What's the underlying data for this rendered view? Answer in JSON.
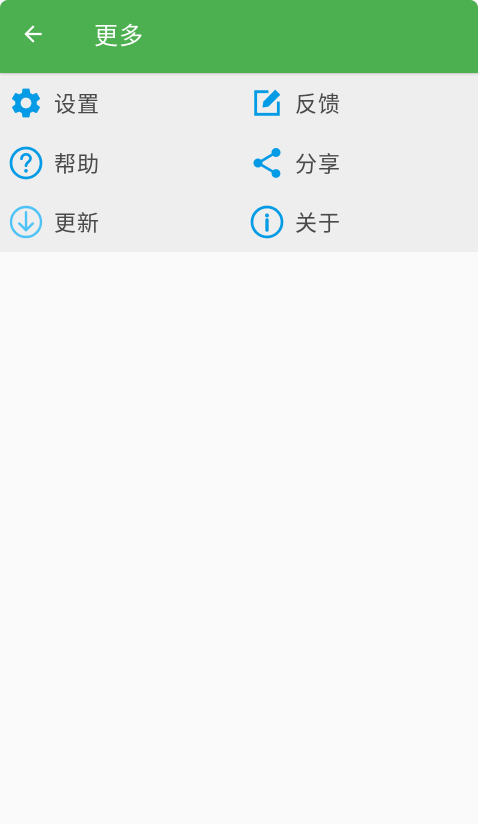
{
  "header": {
    "title": "更多",
    "back_icon": "arrow-left-icon"
  },
  "colors": {
    "appbar": "#4caf50",
    "menu_bg": "#eeeeee",
    "icon_blue": "#039be5",
    "icon_blue_light": "#4fc3f7",
    "page_bg": "#fafafa"
  },
  "menu": {
    "items": [
      {
        "label": "设置",
        "icon": "gear-icon"
      },
      {
        "label": "反馈",
        "icon": "edit-icon"
      },
      {
        "label": "帮助",
        "icon": "help-icon"
      },
      {
        "label": "分享",
        "icon": "share-icon"
      },
      {
        "label": "更新",
        "icon": "download-icon"
      },
      {
        "label": "关于",
        "icon": "info-icon"
      }
    ]
  }
}
